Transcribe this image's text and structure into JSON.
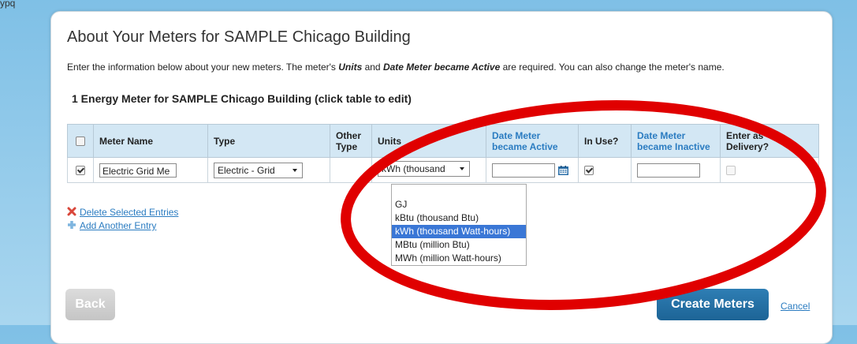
{
  "top_text": "ypq",
  "title": "About Your Meters for SAMPLE Chicago Building",
  "intro": {
    "before": "Enter the information below about your new meters. The meter's ",
    "units_word": "Units",
    "middle": " and ",
    "date_phrase": "Date Meter became Active",
    "after": " are required. You can also change the meter's name."
  },
  "section_heading": "1 Energy Meter for SAMPLE Chicago Building (click table to edit)",
  "table": {
    "headers": {
      "meter_name": "Meter Name",
      "type": "Type",
      "other_type_1": "Other",
      "other_type_2": "Type",
      "units": "Units",
      "date_active_1": "Date Meter",
      "date_active_2": "became Active",
      "in_use": "In Use?",
      "date_inactive_1": "Date Meter",
      "date_inactive_2": "became Inactive",
      "enter_delivery_1": "Enter as",
      "enter_delivery_2": "Delivery?"
    },
    "row": {
      "selected": true,
      "meter_name": "Electric Grid Me",
      "type": "Electric - Grid",
      "other_type": "",
      "units": "kWh (thousand",
      "date_active": "",
      "in_use": true,
      "date_inactive": "",
      "enter_as_delivery": false
    }
  },
  "units_options": [
    "",
    "GJ",
    "kBtu (thousand Btu)",
    "kWh (thousand Watt-hours)",
    "MBtu (million Btu)",
    "MWh (million Watt-hours)"
  ],
  "units_selected_index": 3,
  "actions": {
    "delete": "Delete Selected Entries",
    "add": "Add Another Entry"
  },
  "buttons": {
    "back": "Back",
    "create": "Create Meters",
    "cancel": "Cancel"
  },
  "colors": {
    "link": "#2b7cc1",
    "header_bg": "#d3e7f4",
    "create_button": "#1d6496",
    "highlight": "#3a77d6",
    "annotation_ring": "#e00000"
  }
}
